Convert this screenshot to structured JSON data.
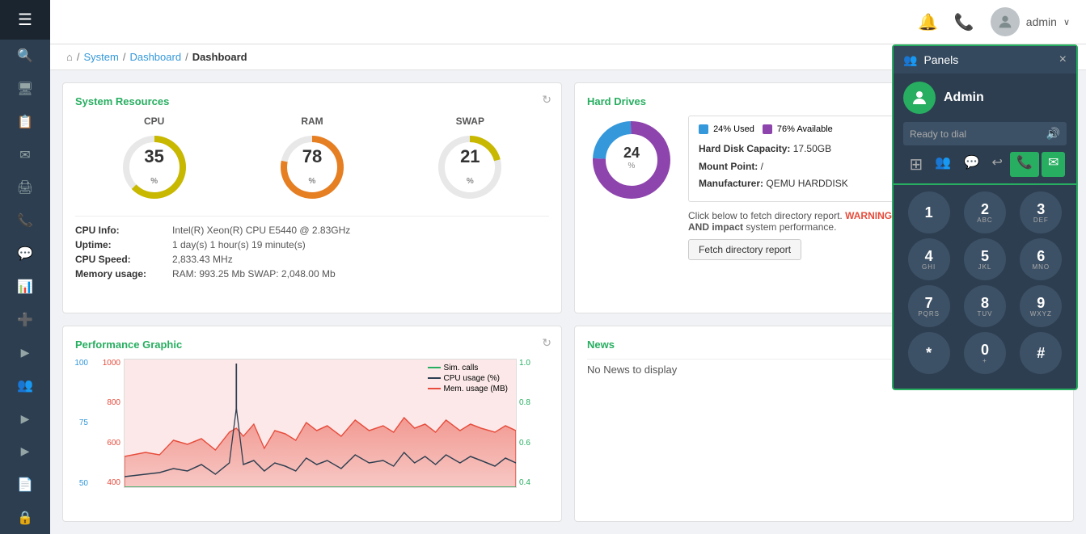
{
  "sidebar": {
    "menu_icon": "☰",
    "items": [
      {
        "name": "search",
        "icon": "🔍"
      },
      {
        "name": "monitor",
        "icon": "🖥"
      },
      {
        "name": "document",
        "icon": "📋"
      },
      {
        "name": "mail",
        "icon": "✉"
      },
      {
        "name": "print",
        "icon": "🖨"
      },
      {
        "name": "phone",
        "icon": "📞"
      },
      {
        "name": "chat",
        "icon": "💬"
      },
      {
        "name": "chart",
        "icon": "📊"
      },
      {
        "name": "plus",
        "icon": "➕"
      },
      {
        "name": "arrow-right",
        "icon": "▶"
      },
      {
        "name": "group",
        "icon": "👥"
      },
      {
        "name": "arrow-right2",
        "icon": "▶"
      },
      {
        "name": "arrow-right3",
        "icon": "▶"
      },
      {
        "name": "arrow-right4",
        "icon": "▶"
      },
      {
        "name": "file",
        "icon": "📄"
      },
      {
        "name": "lock",
        "icon": "🔒"
      }
    ]
  },
  "topbar": {
    "bell_icon": "🔔",
    "phone_icon": "📞",
    "username": "admin",
    "chevron": "∨"
  },
  "breadcrumb": {
    "home_icon": "⌂",
    "system": "System",
    "dashboard": "Dashboard",
    "current": "Dashboard",
    "sep": "/"
  },
  "system_resources": {
    "title": "System Resources",
    "cpu": {
      "label": "CPU",
      "value": "35",
      "unit": "%",
      "color_used": "#c8b800",
      "color_bg": "#e8e8e8"
    },
    "ram": {
      "label": "RAM",
      "value": "78",
      "unit": "%",
      "color_used": "#e67e22",
      "color_bg": "#e8e8e8"
    },
    "swap": {
      "label": "SWAP",
      "value": "21",
      "unit": "%",
      "color_used": "#c8b800",
      "color_bg": "#e8e8e8"
    },
    "info": {
      "cpu_label": "CPU Info:",
      "cpu_value": "Intel(R) Xeon(R) CPU E5440 @ 2.83GHz",
      "uptime_label": "Uptime:",
      "uptime_value": "1 day(s) 1 hour(s) 19 minute(s)",
      "speed_label": "CPU Speed:",
      "speed_value": "2,833.43 MHz",
      "memory_label": "Memory usage:",
      "memory_value": "RAM: 993.25 Mb SWAP: 2,048.00 Mb"
    }
  },
  "hard_drives": {
    "title": "Hard Drives",
    "used_pct": 24,
    "available_pct": 76,
    "legend_used_color": "#3498db",
    "legend_avail_color": "#8e44ad",
    "legend_used_label": "24% Used",
    "legend_avail_label": "76% Available",
    "capacity_label": "Hard Disk Capacity:",
    "capacity_value": "17.50GB",
    "mount_label": "Mount Point:",
    "mount_value": "/",
    "manufacturer_label": "Manufacturer:",
    "manufacturer_value": "QEMU HARDDISK",
    "warning_text": "Click below to fetch directory report. WARNING: this operation may take a long time AND impact system performance.",
    "fetch_btn": "Fetch directory report",
    "warning_color": "#e74c3c"
  },
  "performance": {
    "title": "Performance Graphic",
    "legend": [
      {
        "label": "Sim. calls",
        "color": "#27ae60"
      },
      {
        "label": "CPU usage (%)",
        "color": "#2c3e50"
      },
      {
        "label": "Mem. usage (MB)",
        "color": "#e74c3c"
      }
    ],
    "y_left_labels": [
      "1000",
      "800",
      "600",
      "400"
    ],
    "y_blue_labels": [
      "100",
      "75",
      "50"
    ],
    "y_right_labels": [
      "1.0",
      "0.8",
      "0.6",
      "0.4"
    ]
  },
  "news": {
    "title": "News",
    "content": "No News to display"
  },
  "panels": {
    "title": "Panels",
    "close": "×",
    "username": "Admin",
    "status": "Ready to dial",
    "tabs": [
      {
        "name": "grid",
        "icon": "⊞"
      },
      {
        "name": "users",
        "icon": "👥"
      },
      {
        "name": "chat",
        "icon": "💬"
      },
      {
        "name": "history",
        "icon": "↩"
      },
      {
        "name": "call",
        "icon": "📞"
      },
      {
        "name": "sms",
        "icon": "✉"
      }
    ],
    "dialpad": [
      {
        "num": "1",
        "letters": ""
      },
      {
        "num": "2",
        "letters": "ABC"
      },
      {
        "num": "3",
        "letters": "DEF"
      },
      {
        "num": "4",
        "letters": "GHI"
      },
      {
        "num": "5",
        "letters": "JKL"
      },
      {
        "num": "6",
        "letters": "MNO"
      },
      {
        "num": "7",
        "letters": "PQRS"
      },
      {
        "num": "8",
        "letters": "TUV"
      },
      {
        "num": "9",
        "letters": "WXYZ"
      },
      {
        "num": "*",
        "letters": ""
      },
      {
        "num": "0",
        "letters": "+"
      },
      {
        "num": "#",
        "letters": ""
      }
    ]
  }
}
